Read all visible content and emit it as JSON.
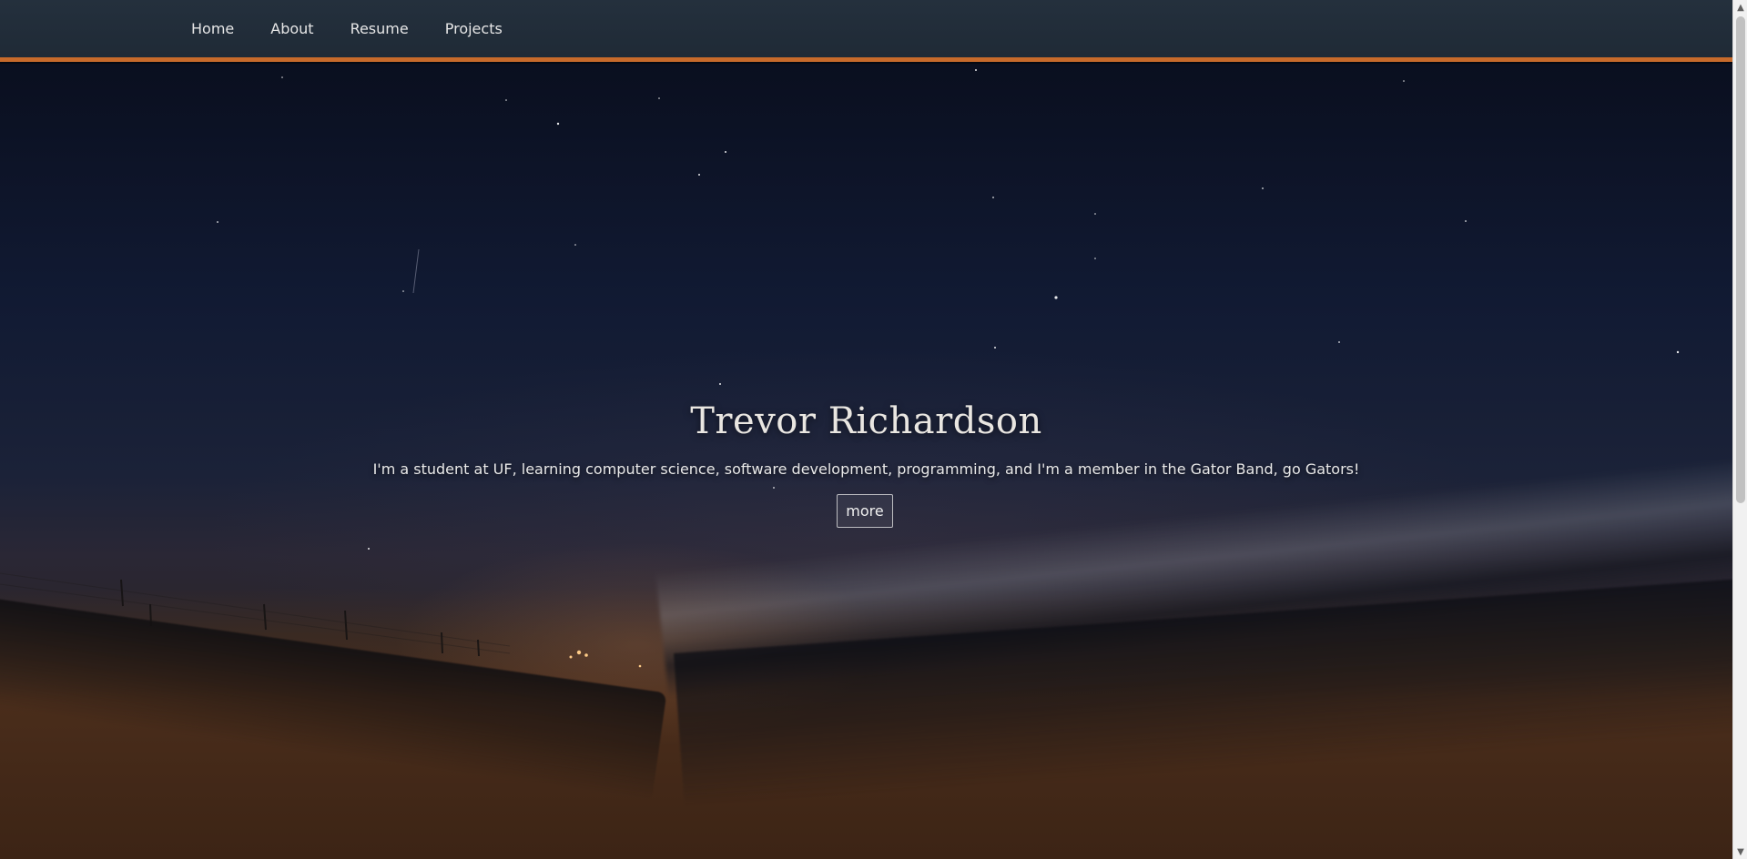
{
  "nav": {
    "items": [
      {
        "label": "Home"
      },
      {
        "label": "About"
      },
      {
        "label": "Resume"
      },
      {
        "label": "Projects"
      }
    ]
  },
  "hero": {
    "title": "Trevor Richardson",
    "subtitle": "I'm a student at UF, learning computer science, software development, programming, and I'm a member in the Gator Band, go Gators!",
    "button_label": "more"
  },
  "colors": {
    "navbar_bg": "#24303d",
    "accent_orange": "#c76a2b",
    "night_sky": "#111a33",
    "sand": "#4a2d1b"
  },
  "icons": {
    "scroll_up": "chevron-up-icon",
    "scroll_down": "chevron-down-icon"
  }
}
